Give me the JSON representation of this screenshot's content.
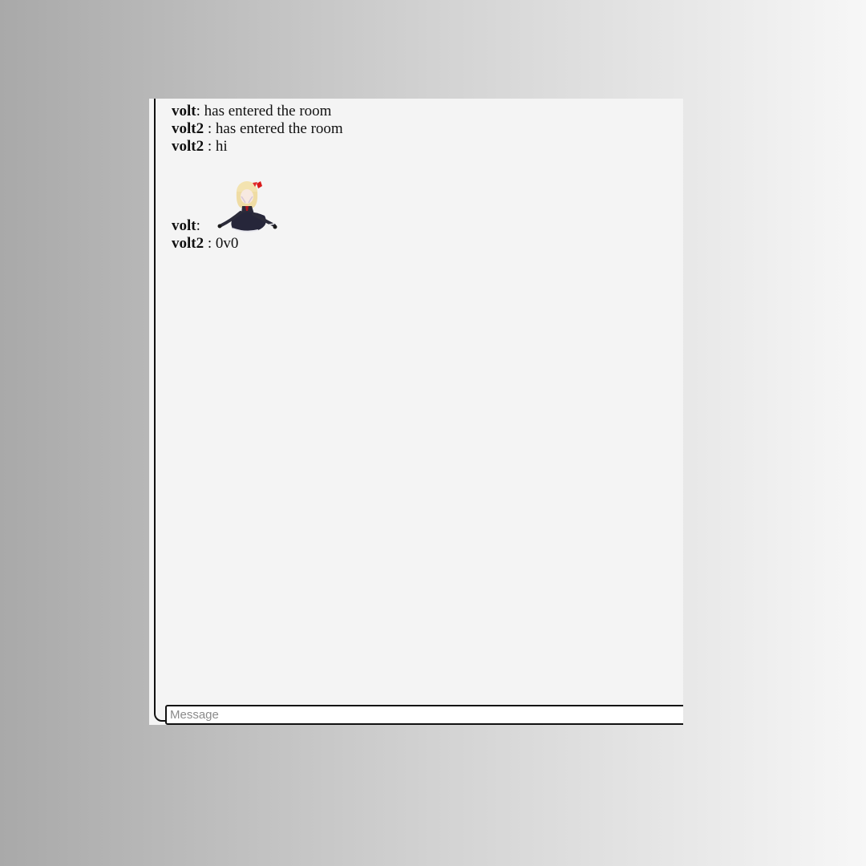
{
  "messages": [
    {
      "user": "volt",
      "sep": ":",
      "text": " has entered the room"
    },
    {
      "user": "volt2",
      "sep": " :",
      "text": " has entered the room"
    },
    {
      "user": "volt2",
      "sep": " :",
      "text": " hi"
    },
    {
      "user": "volt",
      "sep": ":",
      "sticker": "chibi-character-sticker"
    },
    {
      "user": "volt2",
      "sep": " :",
      "text": " 0v0"
    }
  ],
  "composer": {
    "placeholder": "Message",
    "value": ""
  },
  "colors": {
    "panel_bg": "#f4f4f4",
    "border": "#111111",
    "page_gradient_left": "#a9a9a9",
    "page_gradient_right": "#f7f7f7"
  }
}
